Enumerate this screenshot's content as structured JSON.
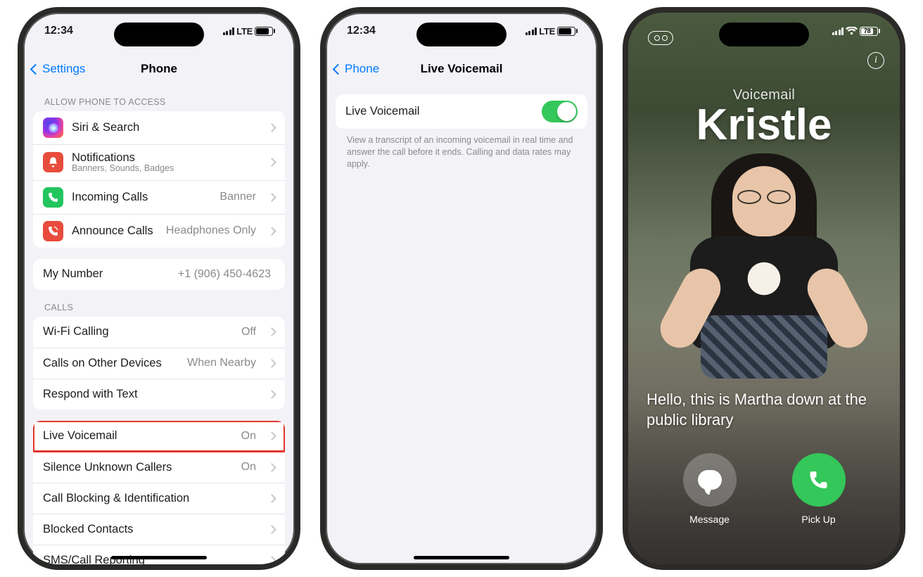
{
  "p1": {
    "status": {
      "time": "12:34",
      "net": "LTE",
      "battery": "84"
    },
    "nav": {
      "back": "Settings",
      "title": "Phone"
    },
    "section_access": "Allow Phone to Access",
    "rows_access": [
      {
        "label": "Siri & Search",
        "value": "",
        "sub": ""
      },
      {
        "label": "Notifications",
        "value": "",
        "sub": "Banners, Sounds, Badges"
      },
      {
        "label": "Incoming Calls",
        "value": "Banner",
        "sub": ""
      },
      {
        "label": "Announce Calls",
        "value": "Headphones Only",
        "sub": ""
      }
    ],
    "my_number": {
      "label": "My Number",
      "value": "+1 (906) 450-4623"
    },
    "section_calls": "Calls",
    "rows_calls1": [
      {
        "label": "Wi-Fi Calling",
        "value": "Off"
      },
      {
        "label": "Calls on Other Devices",
        "value": "When Nearby"
      },
      {
        "label": "Respond with Text",
        "value": ""
      }
    ],
    "rows_calls2": [
      {
        "label": "Live Voicemail",
        "value": "On",
        "hl": true
      },
      {
        "label": "Silence Unknown Callers",
        "value": "On"
      },
      {
        "label": "Call Blocking & Identification",
        "value": ""
      },
      {
        "label": "Blocked Contacts",
        "value": ""
      },
      {
        "label": "SMS/Call Reporting",
        "value": ""
      }
    ]
  },
  "p2": {
    "status": {
      "time": "12:34",
      "net": "LTE",
      "battery": "84"
    },
    "nav": {
      "back": "Phone",
      "title": "Live Voicemail"
    },
    "toggle_label": "Live Voicemail",
    "footer": "View a transcript of an incoming voicemail in real time and answer the call before it ends. Calling and data rates may apply."
  },
  "p3": {
    "status": {
      "battery": "78"
    },
    "header_sub": "Voicemail",
    "caller": "Kristle",
    "transcript": "Hello, this is Martha down at the public library",
    "actions": {
      "message": "Message",
      "pickup": "Pick Up"
    }
  }
}
